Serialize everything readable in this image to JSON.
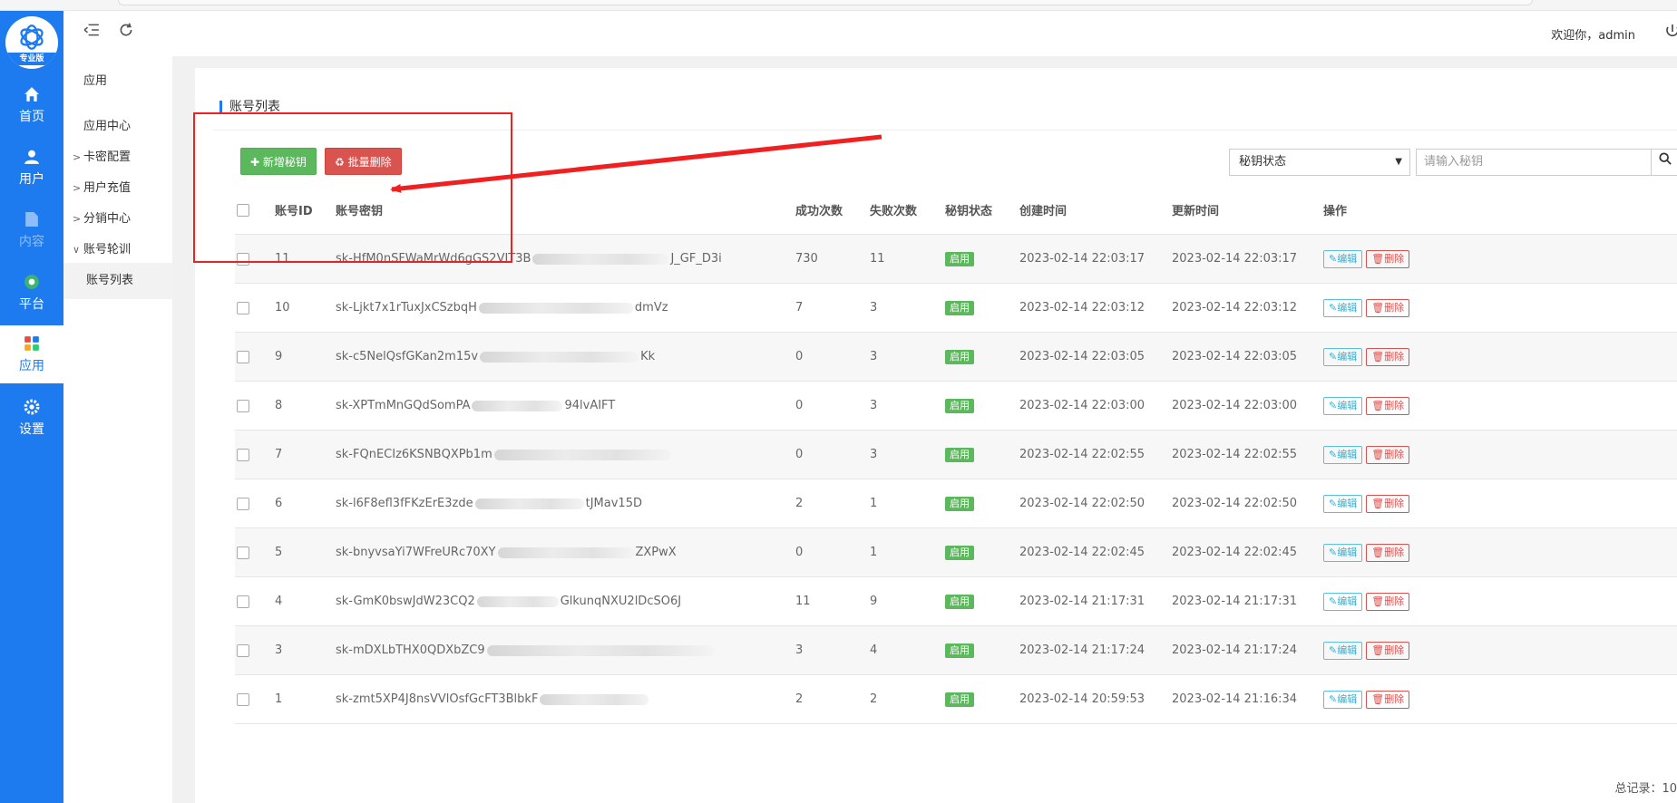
{
  "sidebar": {
    "logo_ribbon": "专业版",
    "items": [
      {
        "label": "首页",
        "icon": "home-icon"
      },
      {
        "label": "用户",
        "icon": "user-icon"
      },
      {
        "label": "内容",
        "icon": "file-icon"
      },
      {
        "label": "平台",
        "icon": "platform-icon"
      },
      {
        "label": "应用",
        "icon": "apps-icon"
      },
      {
        "label": "设置",
        "icon": "gear-icon"
      }
    ]
  },
  "subnav": {
    "header": "应用",
    "items": [
      "应用中心",
      "卡密配置",
      "用户充值",
      "分销中心",
      "账号轮训"
    ],
    "child": "账号列表"
  },
  "header": {
    "welcome": "欢迎你，admin"
  },
  "panel": {
    "title": "账号列表",
    "add_button": "新增秘钥",
    "batch_delete_button": "批量删除",
    "status_select": "秘钥状态",
    "search_placeholder": "请输入秘钥"
  },
  "table": {
    "columns": [
      "账号ID",
      "账号密钥",
      "成功次数",
      "失败次数",
      "秘钥状态",
      "创建时间",
      "更新时间",
      "操作"
    ],
    "edit_label": "编辑",
    "delete_label": "删除",
    "rows": [
      {
        "id": "11",
        "key_head": "sk-HfM0nSFWaMrWd6gGS2VIT3B",
        "key_tail": "J_GF_D3i",
        "success": "730",
        "fail": "11",
        "status": "启用",
        "created": "2023-02-14 22:03:17",
        "updated": "2023-02-14 22:03:17"
      },
      {
        "id": "10",
        "key_head": "sk-Ljkt7x1rTuxJxCSzbqH",
        "key_tail": "dmVz",
        "success": "7",
        "fail": "3",
        "status": "启用",
        "created": "2023-02-14 22:03:12",
        "updated": "2023-02-14 22:03:12"
      },
      {
        "id": "9",
        "key_head": "sk-c5NelQsfGKan2m15v",
        "key_tail": "Kk",
        "success": "0",
        "fail": "3",
        "status": "启用",
        "created": "2023-02-14 22:03:05",
        "updated": "2023-02-14 22:03:05"
      },
      {
        "id": "8",
        "key_head": "sk-XPTmMnGQdSomPA",
        "key_tail": "94lvAIFT",
        "success": "0",
        "fail": "3",
        "status": "启用",
        "created": "2023-02-14 22:03:00",
        "updated": "2023-02-14 22:03:00"
      },
      {
        "id": "7",
        "key_head": "sk-FQnECIz6KSNBQXPb1m",
        "key_tail": "",
        "success": "0",
        "fail": "3",
        "status": "启用",
        "created": "2023-02-14 22:02:55",
        "updated": "2023-02-14 22:02:55"
      },
      {
        "id": "6",
        "key_head": "sk-l6F8efl3fFKzErE3zde",
        "key_tail": "tJMav15D",
        "success": "2",
        "fail": "1",
        "status": "启用",
        "created": "2023-02-14 22:02:50",
        "updated": "2023-02-14 22:02:50"
      },
      {
        "id": "5",
        "key_head": "sk-bnyvsaYi7WFreURc70XY",
        "key_tail": "ZXPwX",
        "success": "0",
        "fail": "1",
        "status": "启用",
        "created": "2023-02-14 22:02:45",
        "updated": "2023-02-14 22:02:45"
      },
      {
        "id": "4",
        "key_head": "sk-GmK0bswJdW23CQ2",
        "key_tail": "GlkunqNXU2lDcSO6J",
        "success": "11",
        "fail": "9",
        "status": "启用",
        "created": "2023-02-14 21:17:31",
        "updated": "2023-02-14 21:17:31"
      },
      {
        "id": "3",
        "key_head": "sk-mDXLbTHX0QDXbZC9",
        "key_tail": "",
        "success": "3",
        "fail": "4",
        "status": "启用",
        "created": "2023-02-14 21:17:24",
        "updated": "2023-02-14 21:17:24"
      },
      {
        "id": "1",
        "key_head": "sk-zmt5XP4J8nsVVlOsfGcFT3BlbkF",
        "key_tail": "",
        "success": "2",
        "fail": "2",
        "status": "启用",
        "created": "2023-02-14 20:59:53",
        "updated": "2023-02-14 21:16:34"
      }
    ]
  },
  "footer": {
    "total": "总记录：10"
  },
  "colors": {
    "brand": "#1e7bef",
    "add": "#5cb85c",
    "danger": "#d9534f",
    "annotation": "#f02020"
  }
}
